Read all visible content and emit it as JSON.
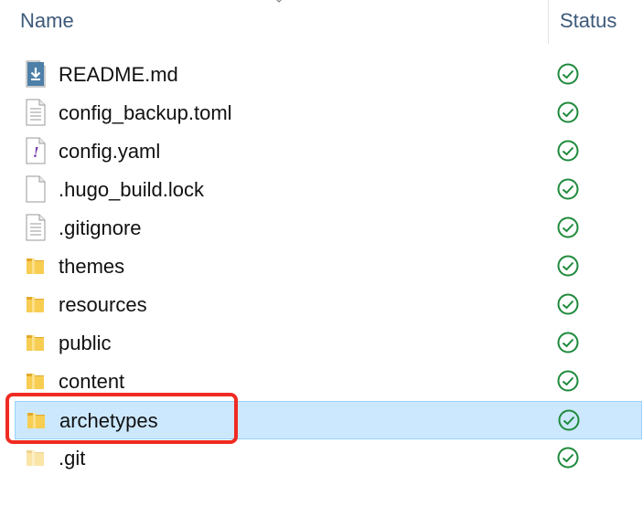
{
  "header": {
    "name_label": "Name",
    "status_label": "Status"
  },
  "files": [
    {
      "name": "README.md",
      "icon": "markdown-download-icon",
      "status": "synced"
    },
    {
      "name": "config_backup.toml",
      "icon": "text-file-icon",
      "status": "synced"
    },
    {
      "name": "config.yaml",
      "icon": "yaml-file-icon",
      "status": "synced"
    },
    {
      "name": ".hugo_build.lock",
      "icon": "blank-file-icon",
      "status": "synced"
    },
    {
      "name": ".gitignore",
      "icon": "text-file-icon",
      "status": "synced"
    },
    {
      "name": "themes",
      "icon": "folder-icon",
      "status": "synced"
    },
    {
      "name": "resources",
      "icon": "folder-icon",
      "status": "synced"
    },
    {
      "name": "public",
      "icon": "folder-icon",
      "status": "synced"
    },
    {
      "name": "content",
      "icon": "folder-icon",
      "status": "synced"
    },
    {
      "name": "archetypes",
      "icon": "folder-icon",
      "status": "synced",
      "selected": true
    },
    {
      "name": ".git",
      "icon": "hidden-folder-icon",
      "status": "synced"
    }
  ],
  "colors": {
    "selection": "#cce8ff",
    "highlight_box": "#ef2b22",
    "status_ok": "#1e8a3c",
    "folder": "#f5c84c"
  }
}
